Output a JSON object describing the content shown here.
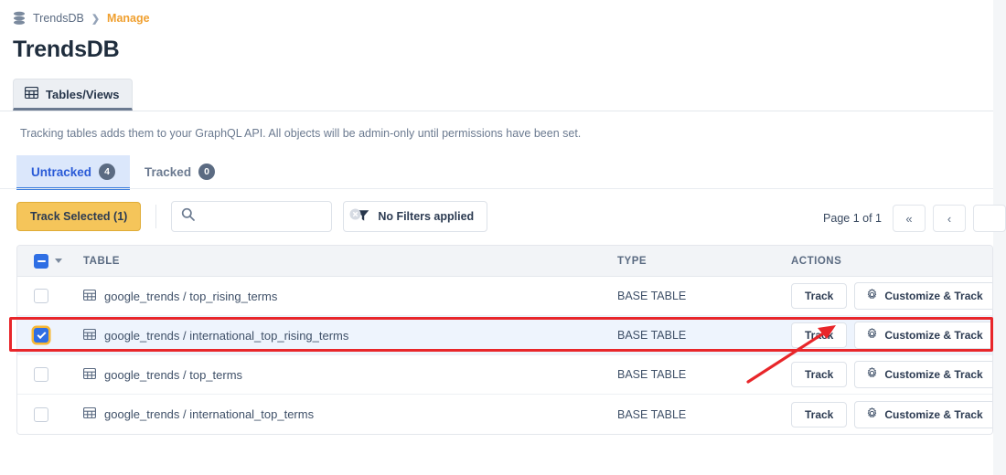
{
  "breadcrumb": {
    "icon": "database-icon",
    "root": "TrendsDB",
    "separator": "❯",
    "current": "Manage"
  },
  "page_title": "TrendsDB",
  "top_tabs": [
    {
      "label": "Tables/Views",
      "icon": "table-grid-icon",
      "active": true
    }
  ],
  "description": "Tracking tables adds them to your GraphQL API. All objects will be admin-only until permissions have been set.",
  "sub_tabs": [
    {
      "label": "Untracked",
      "count": "4",
      "active": true
    },
    {
      "label": "Tracked",
      "count": "0",
      "active": false
    }
  ],
  "toolbar": {
    "track_selected_label": "Track Selected (1)",
    "search_value": "",
    "search_placeholder": "",
    "search_icon": "search-icon",
    "clear_icon": "clear-circle-icon",
    "filters_label": "No Filters applied",
    "filters_icon": "funnel-icon"
  },
  "pagination": {
    "page_label": "Page 1 of 1",
    "first_label": "«",
    "prev_label": "‹"
  },
  "table": {
    "columns": {
      "table": "TABLE",
      "type": "TYPE",
      "actions": "ACTIONS"
    },
    "header_checkbox_state": "indeterminate",
    "rows": [
      {
        "checked": false,
        "icon": "table-grid-icon",
        "name": "google_trends / top_rising_terms",
        "type": "BASE TABLE",
        "track_label": "Track",
        "customize_label": "Customize & Track",
        "customize_icon": "gear-icon",
        "highlighted": false
      },
      {
        "checked": true,
        "icon": "table-grid-icon",
        "name": "google_trends / international_top_rising_terms",
        "type": "BASE TABLE",
        "track_label": "Track",
        "customize_label": "Customize & Track",
        "customize_icon": "gear-icon",
        "highlighted": true
      },
      {
        "checked": false,
        "icon": "table-grid-icon",
        "name": "google_trends / top_terms",
        "type": "BASE TABLE",
        "track_label": "Track",
        "customize_label": "Customize & Track",
        "customize_icon": "gear-icon",
        "highlighted": false
      },
      {
        "checked": false,
        "icon": "table-grid-icon",
        "name": "google_trends / international_top_terms",
        "type": "BASE TABLE",
        "track_label": "Track",
        "customize_label": "Customize & Track",
        "customize_icon": "gear-icon",
        "highlighted": false
      }
    ]
  },
  "annotations": {
    "highlight_color": "#e8262a",
    "arrow_target": "track-button-row-2"
  },
  "colors": {
    "accent_blue": "#2f6fe4",
    "amber_button": "#f5c55a",
    "breadcrumb_current": "#f0a030",
    "annotation_red": "#e8262a"
  }
}
